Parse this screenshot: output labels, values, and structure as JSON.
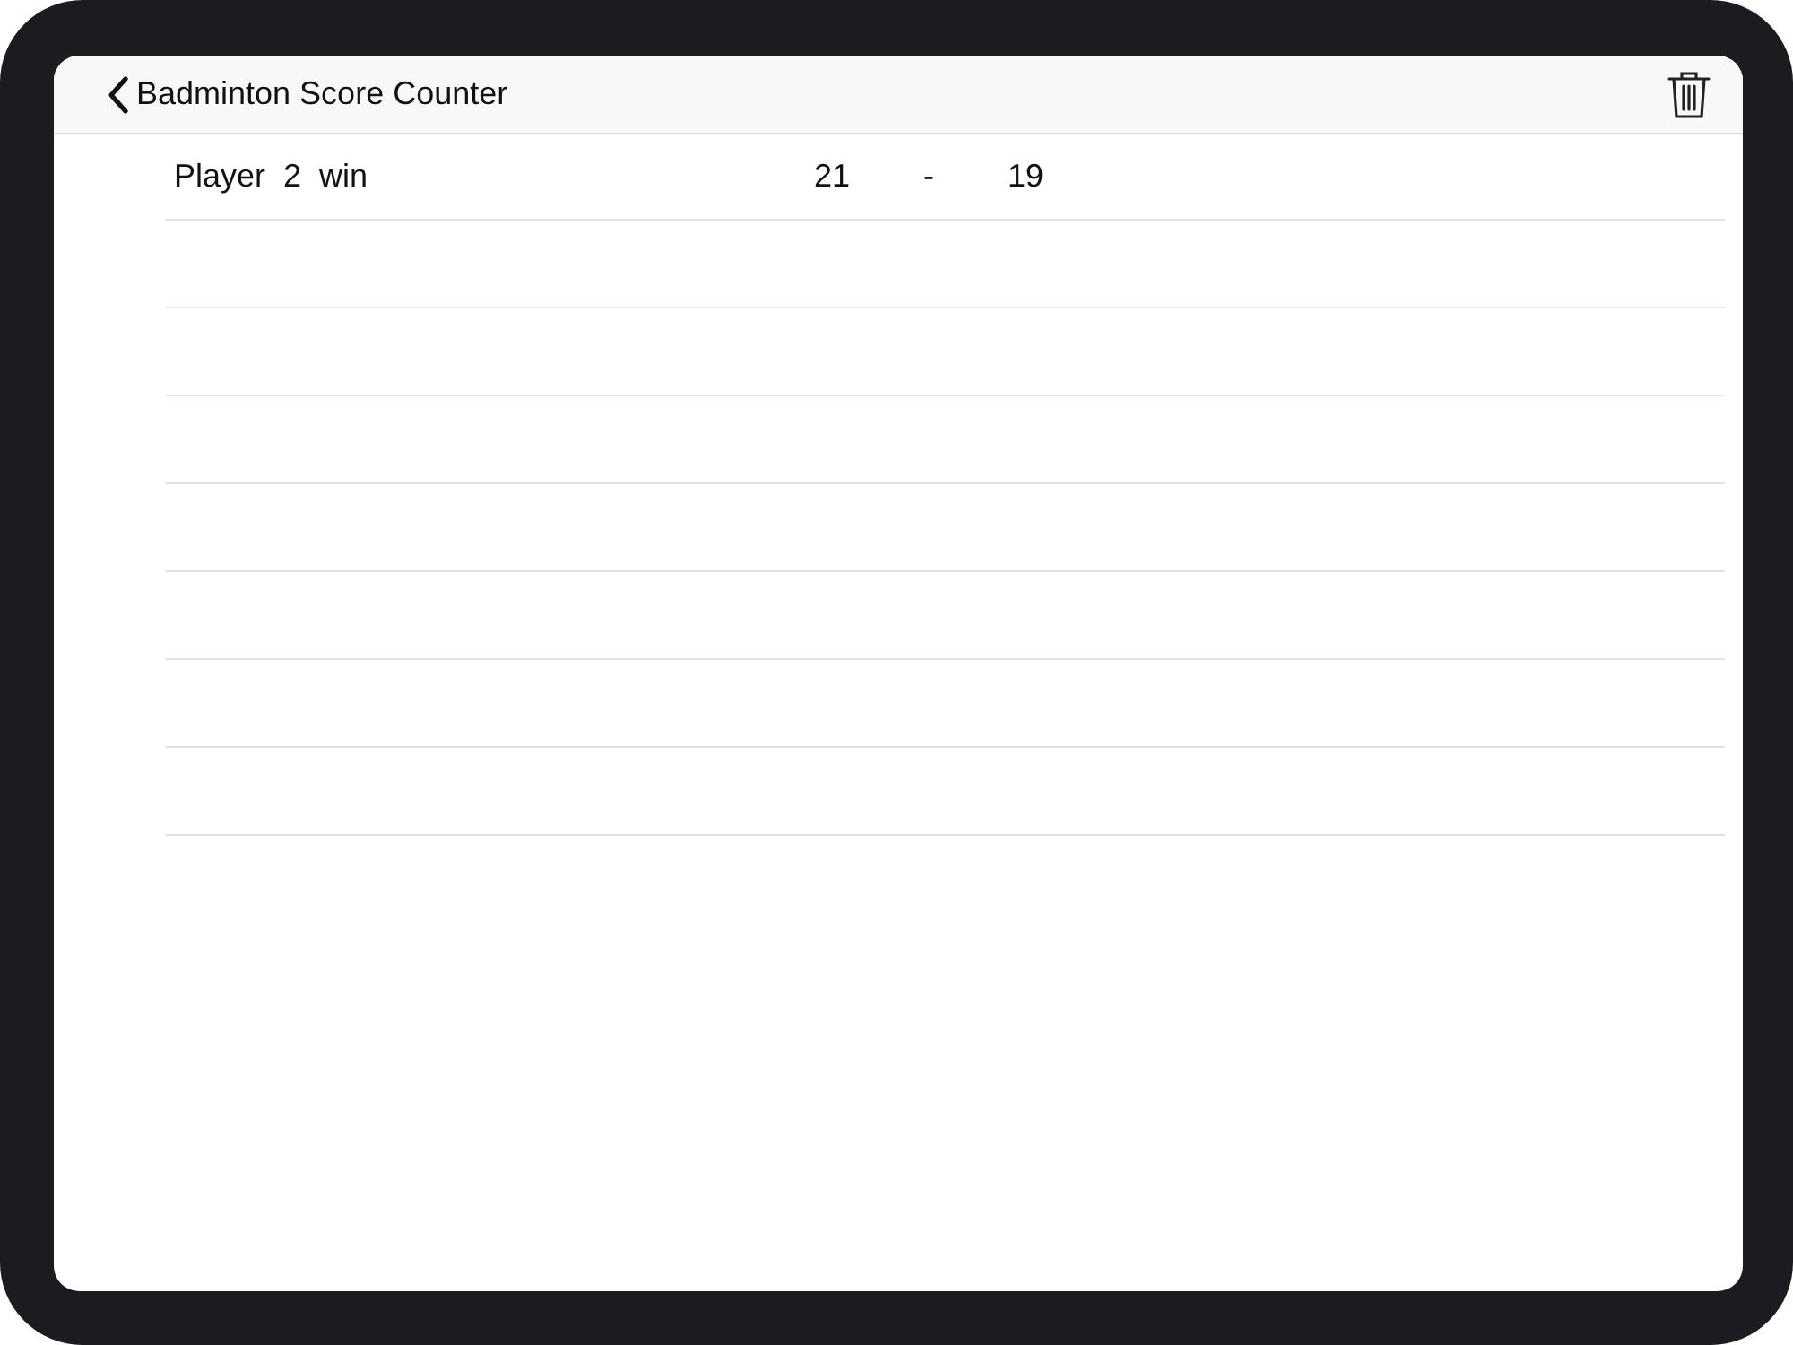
{
  "nav_bar": {
    "back_label": "Badminton Score Counter"
  },
  "results": [
    {
      "outcome": "Player  2  win",
      "score_1": "21",
      "separator": "-",
      "score_2": "19"
    }
  ]
}
